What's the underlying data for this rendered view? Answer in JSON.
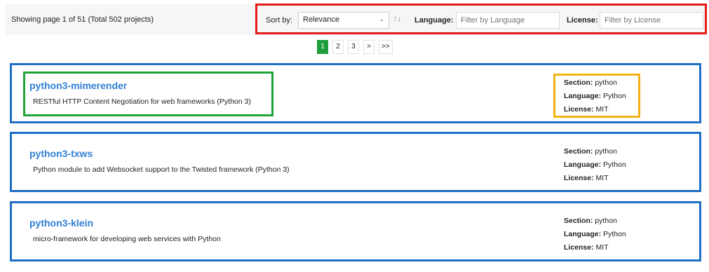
{
  "summary": {
    "showing": "Showing page 1 of 51 (Total 502 projects)"
  },
  "controls": {
    "sort_label": "Sort by:",
    "sort_value": "Relevance",
    "sort_arrows": "↑↓",
    "language_label": "Language:",
    "language_placeholder": "Filter by Language",
    "license_label": "License:",
    "license_placeholder": "Filter by License"
  },
  "pagination": {
    "pages": [
      "1",
      "2",
      "3",
      ">",
      ">>"
    ],
    "current": "1"
  },
  "labels": {
    "section": "Section:",
    "language": "Language:",
    "license": "License:"
  },
  "projects": [
    {
      "name": "python3-mimerender",
      "description": "RESTful HTTP Content Negotiation for web frameworks (Python 3)",
      "section": "python",
      "language": "Python",
      "license": "MIT"
    },
    {
      "name": "python3-txws",
      "description": "Python module to add Websocket support to the Twisted framework (Python 3)",
      "section": "python",
      "language": "Python",
      "license": "MIT"
    },
    {
      "name": "python3-klein",
      "description": "micro-framework for developing web services with Python",
      "section": "python",
      "language": "Python",
      "license": "MIT"
    }
  ],
  "colors": {
    "controls_highlight": "#e31b1b",
    "title_highlight": "#1fa33a",
    "meta_highlight": "#f2b214",
    "card_border": "#1f6fc5",
    "link": "#2f7fd6",
    "active_page": "#1e9e3c"
  }
}
